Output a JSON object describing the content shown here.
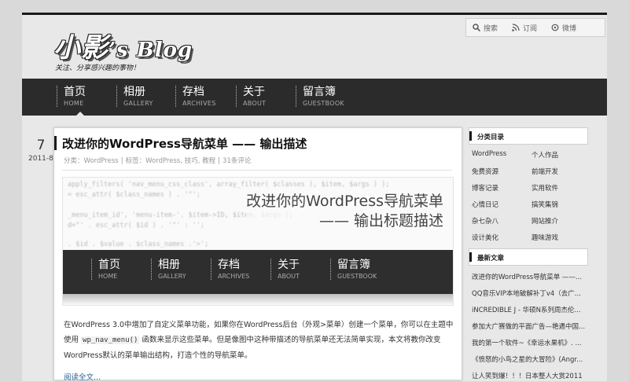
{
  "header": {
    "logo_main": "小影",
    "logo_suffix": "’s Blog",
    "tagline": "关注、分享感兴趣的事物！"
  },
  "utility": {
    "search": "搜索",
    "subscribe": "订阅",
    "weibo": "微博"
  },
  "nav": [
    {
      "cn": "首页",
      "en": "HOME"
    },
    {
      "cn": "相册",
      "en": "GALLERY"
    },
    {
      "cn": "存档",
      "en": "ARCHIVES"
    },
    {
      "cn": "关于",
      "en": "ABOUT"
    },
    {
      "cn": "留言簿",
      "en": "GUESTBOOK"
    }
  ],
  "post": {
    "day": "7",
    "year_month": "2011-8",
    "title": "改进你的WordPress导航菜单 —— 输出描述",
    "meta": {
      "category_prefix": "分类：",
      "category": "WordPress",
      "tags_prefix": "标签：",
      "tags": "WordPress, 技巧, 教程",
      "comments": "31条评论"
    },
    "thumb": {
      "line1": "改进你的WordPress导航菜单",
      "line2": "—— 输出标题描述",
      "code_lines": [
        "apply_filters( 'nav_menu_css_class', array_filter( $classes ), $item, $args ) );",
        "  = esc_attr( $class_names ) . '\"';",
        "",
        "  _menu_item_id', 'menu-item-'. $item->ID, $item, $args );",
        "  d=\"' . esc_attr( $id ) . '\"' : '';",
        "",
        "  . $id . $value . $class_names .'>';"
      ]
    },
    "excerpt_part1": "在WordPress 3.0中增加了自定义菜单功能，如果你在WordPress后台（外观>菜单）创建一个菜单，你可以在主题中使用 ",
    "excerpt_code": "wp_nav_menu()",
    "excerpt_part2": " 函数来显示这些菜单。但是像图中这种带描述的导航菜单还无法简单实现，本文将教你改变WordPress默认的菜单输出结构，打造个性的导航菜单。",
    "read_more": "阅读全文..."
  },
  "sidebar": {
    "categories_title": "分类目录",
    "categories": [
      [
        "WordPress",
        "个人作品"
      ],
      [
        "免费资源",
        "前端开发"
      ],
      [
        "博客记录",
        "实用软件"
      ],
      [
        "心情日记",
        "搞笑集锦"
      ],
      [
        "杂七杂八",
        "网站推介"
      ],
      [
        "设计美化",
        "趣味游戏"
      ]
    ],
    "recent_title": "最新文章",
    "recent": [
      "改进你的WordPress导航菜单 ——...",
      "QQ音乐VIP本地破解补丁v4（去广...",
      "iNCREDIBLE J - 华硕N系列周杰伦...",
      "参加大广赛做的平面广告—艳遇中国...",
      "我的第一个软件~《幸运水果机》. ...",
      "《愤怒的小鸟之星的大冒险》(Angr...",
      "让人笑到爆！！！日本整人大赏2011"
    ]
  }
}
